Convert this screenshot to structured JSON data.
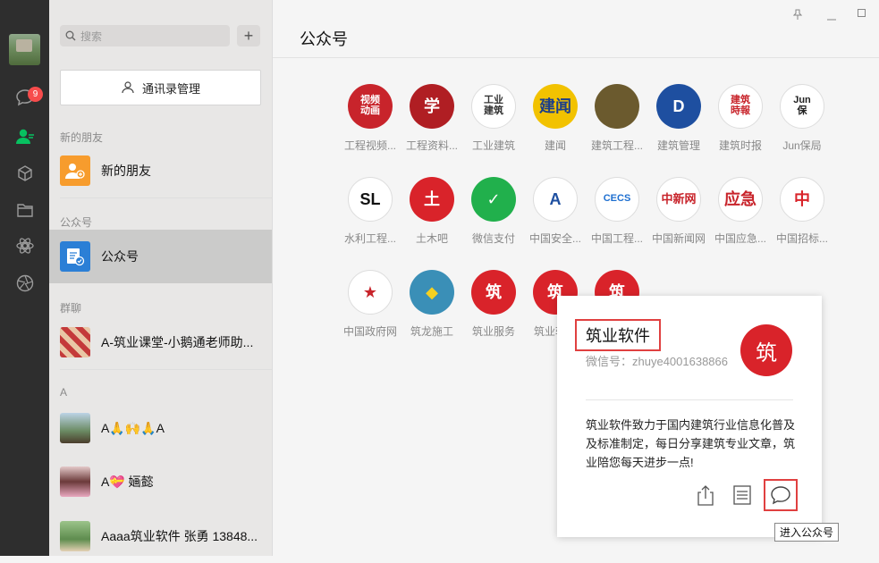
{
  "leftbar": {
    "unread_count": "9",
    "icons": [
      "chat-icon",
      "contacts-icon",
      "cube-icon",
      "folder-icon",
      "moments-icon",
      "aperture-icon"
    ]
  },
  "contacts": {
    "search_placeholder": "搜索",
    "plus": "+",
    "manage_label": "通讯录管理",
    "section_new": "新的朋友",
    "new_friends": "新的朋友",
    "section_official": "公众号",
    "official": "公众号",
    "section_group": "群聊",
    "group_name": "A-筑业课堂-小鹅通老师助...",
    "section_a": "A",
    "contact_1": "A🙏🙌🙏A",
    "contact_2": "A💝 婳懿",
    "contact_3": "Aaaa筑业软件 张勇 13848..."
  },
  "main": {
    "title": "公众号",
    "accounts": [
      {
        "label": "工程视频...",
        "icon_text": "视频\n动画",
        "bg": "#c8242b",
        "fg": "#fff"
      },
      {
        "label": "工程资料...",
        "icon_text": "学",
        "bg": "#b01e23",
        "fg": "#fff"
      },
      {
        "label": "工业建筑",
        "icon_text": "工业\n建筑",
        "bg": "#ffffff",
        "fg": "#333"
      },
      {
        "label": "建闻",
        "icon_text": "建闻",
        "bg": "#f2c200",
        "fg": "#1b3e8a"
      },
      {
        "label": "建筑工程...",
        "icon_text": "",
        "bg": "#6b5a2e",
        "fg": "#fff"
      },
      {
        "label": "建筑管理",
        "icon_text": "D",
        "bg": "#1e4fa0",
        "fg": "#fff"
      },
      {
        "label": "建筑时报",
        "icon_text": "建筑\n時報",
        "bg": "#ffffff",
        "fg": "#c8242b"
      },
      {
        "label": "Jun保局",
        "icon_text": "Jun\n保",
        "bg": "#ffffff",
        "fg": "#222"
      },
      {
        "label": "水利工程...",
        "icon_text": "SL",
        "bg": "#ffffff",
        "fg": "#111"
      },
      {
        "label": "土木吧",
        "icon_text": "土",
        "bg": "#d9232a",
        "fg": "#fff"
      },
      {
        "label": "微信支付",
        "icon_text": "✓",
        "bg": "#21b04c",
        "fg": "#fff"
      },
      {
        "label": "中国安全...",
        "icon_text": "A",
        "bg": "#ffffff",
        "fg": "#1e4fa0"
      },
      {
        "label": "中国工程...",
        "icon_text": "CECS",
        "bg": "#ffffff",
        "fg": "#1e6fd0"
      },
      {
        "label": "中国新闻网",
        "icon_text": "中新网",
        "bg": "#ffffff",
        "fg": "#c8242b"
      },
      {
        "label": "中国应急...",
        "icon_text": "应急",
        "bg": "#ffffff",
        "fg": "#c8242b"
      },
      {
        "label": "中国招标...",
        "icon_text": "中",
        "bg": "#ffffff",
        "fg": "#d9232a"
      },
      {
        "label": "中国政府网",
        "icon_text": "★",
        "bg": "#ffffff",
        "fg": "#c8242b"
      },
      {
        "label": "筑龙施工",
        "icon_text": "◆",
        "bg": "#3a8fb7",
        "fg": "#f5d020"
      },
      {
        "label": "筑业服务",
        "icon_text": "筑",
        "bg": "#d9232a",
        "fg": "#fff"
      },
      {
        "label": "筑业软件",
        "icon_text": "筑",
        "bg": "#d9232a",
        "fg": "#fff"
      },
      {
        "label": "",
        "icon_text": "筑",
        "bg": "#d9232a",
        "fg": "#fff"
      }
    ]
  },
  "card": {
    "name": "筑业软件",
    "wechat_id": "微信号：zhuye4001638866",
    "logo_text": "筑",
    "description": "筑业软件致力于国内建筑行业信息化普及及标准制定，每日分享建筑专业文章，筑业陪您每天进步一点!",
    "tooltip": "进入公众号"
  }
}
